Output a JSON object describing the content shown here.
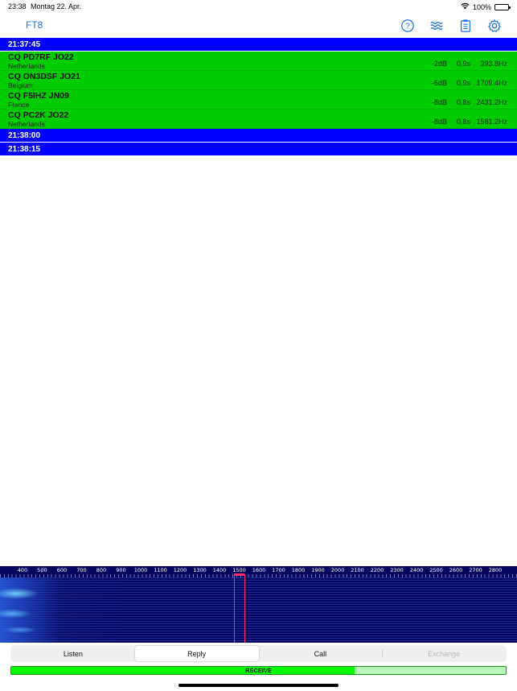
{
  "status_bar": {
    "time": "23:38",
    "date": "Montag 22. Apr.",
    "battery_text": "100%",
    "battery_level": 1.0
  },
  "nav": {
    "title": "FT8",
    "icons": [
      "help-icon",
      "waves-icon",
      "clipboard-icon",
      "gear-icon"
    ],
    "accent_color": "#1a73e8"
  },
  "list": {
    "header_color": "#0000ff",
    "row_color": "#00cc00",
    "groups": [
      {
        "time": "21:37:45",
        "messages": [
          {
            "text": "CQ PD7RF JO22",
            "country": "Netherlands",
            "db": "-2dB",
            "dt": "0.9s",
            "freq": "393.8Hz"
          },
          {
            "text": "CQ ON3DSF JO21",
            "country": "Belgium",
            "db": "-6dB",
            "dt": "0.9s",
            "freq": "1709.4Hz"
          },
          {
            "text": "CQ F5IHZ JN09",
            "country": "France",
            "db": "-8dB",
            "dt": "0.8s",
            "freq": "2431.2Hz"
          },
          {
            "text": "CQ PC2K JO22",
            "country": "Netherlands",
            "db": "-8dB",
            "dt": "0.8s",
            "freq": "1581.2Hz"
          }
        ]
      },
      {
        "time": "21:38:00",
        "messages": []
      },
      {
        "time": "21:38:15",
        "messages": []
      }
    ]
  },
  "waterfall": {
    "scale": [
      "400",
      "500",
      "600",
      "700",
      "800",
      "900",
      "1000",
      "1100",
      "1200",
      "1300",
      "1400",
      "1500",
      "1600",
      "1700",
      "1800",
      "1900",
      "2000",
      "2100",
      "2200",
      "2300",
      "2400",
      "2500",
      "2600",
      "2700",
      "2800"
    ],
    "background_color": "#06055e",
    "marker_color": "#ff2a6a"
  },
  "segments": [
    {
      "label": "Listen",
      "selected": false,
      "disabled": false
    },
    {
      "label": "Reply",
      "selected": true,
      "disabled": false
    },
    {
      "label": "Call",
      "selected": false,
      "disabled": false
    },
    {
      "label": "Exchange",
      "selected": false,
      "disabled": true
    }
  ],
  "progress": {
    "label": "RECEIVE",
    "value": 0.695,
    "fill_color": "#00ff00"
  }
}
